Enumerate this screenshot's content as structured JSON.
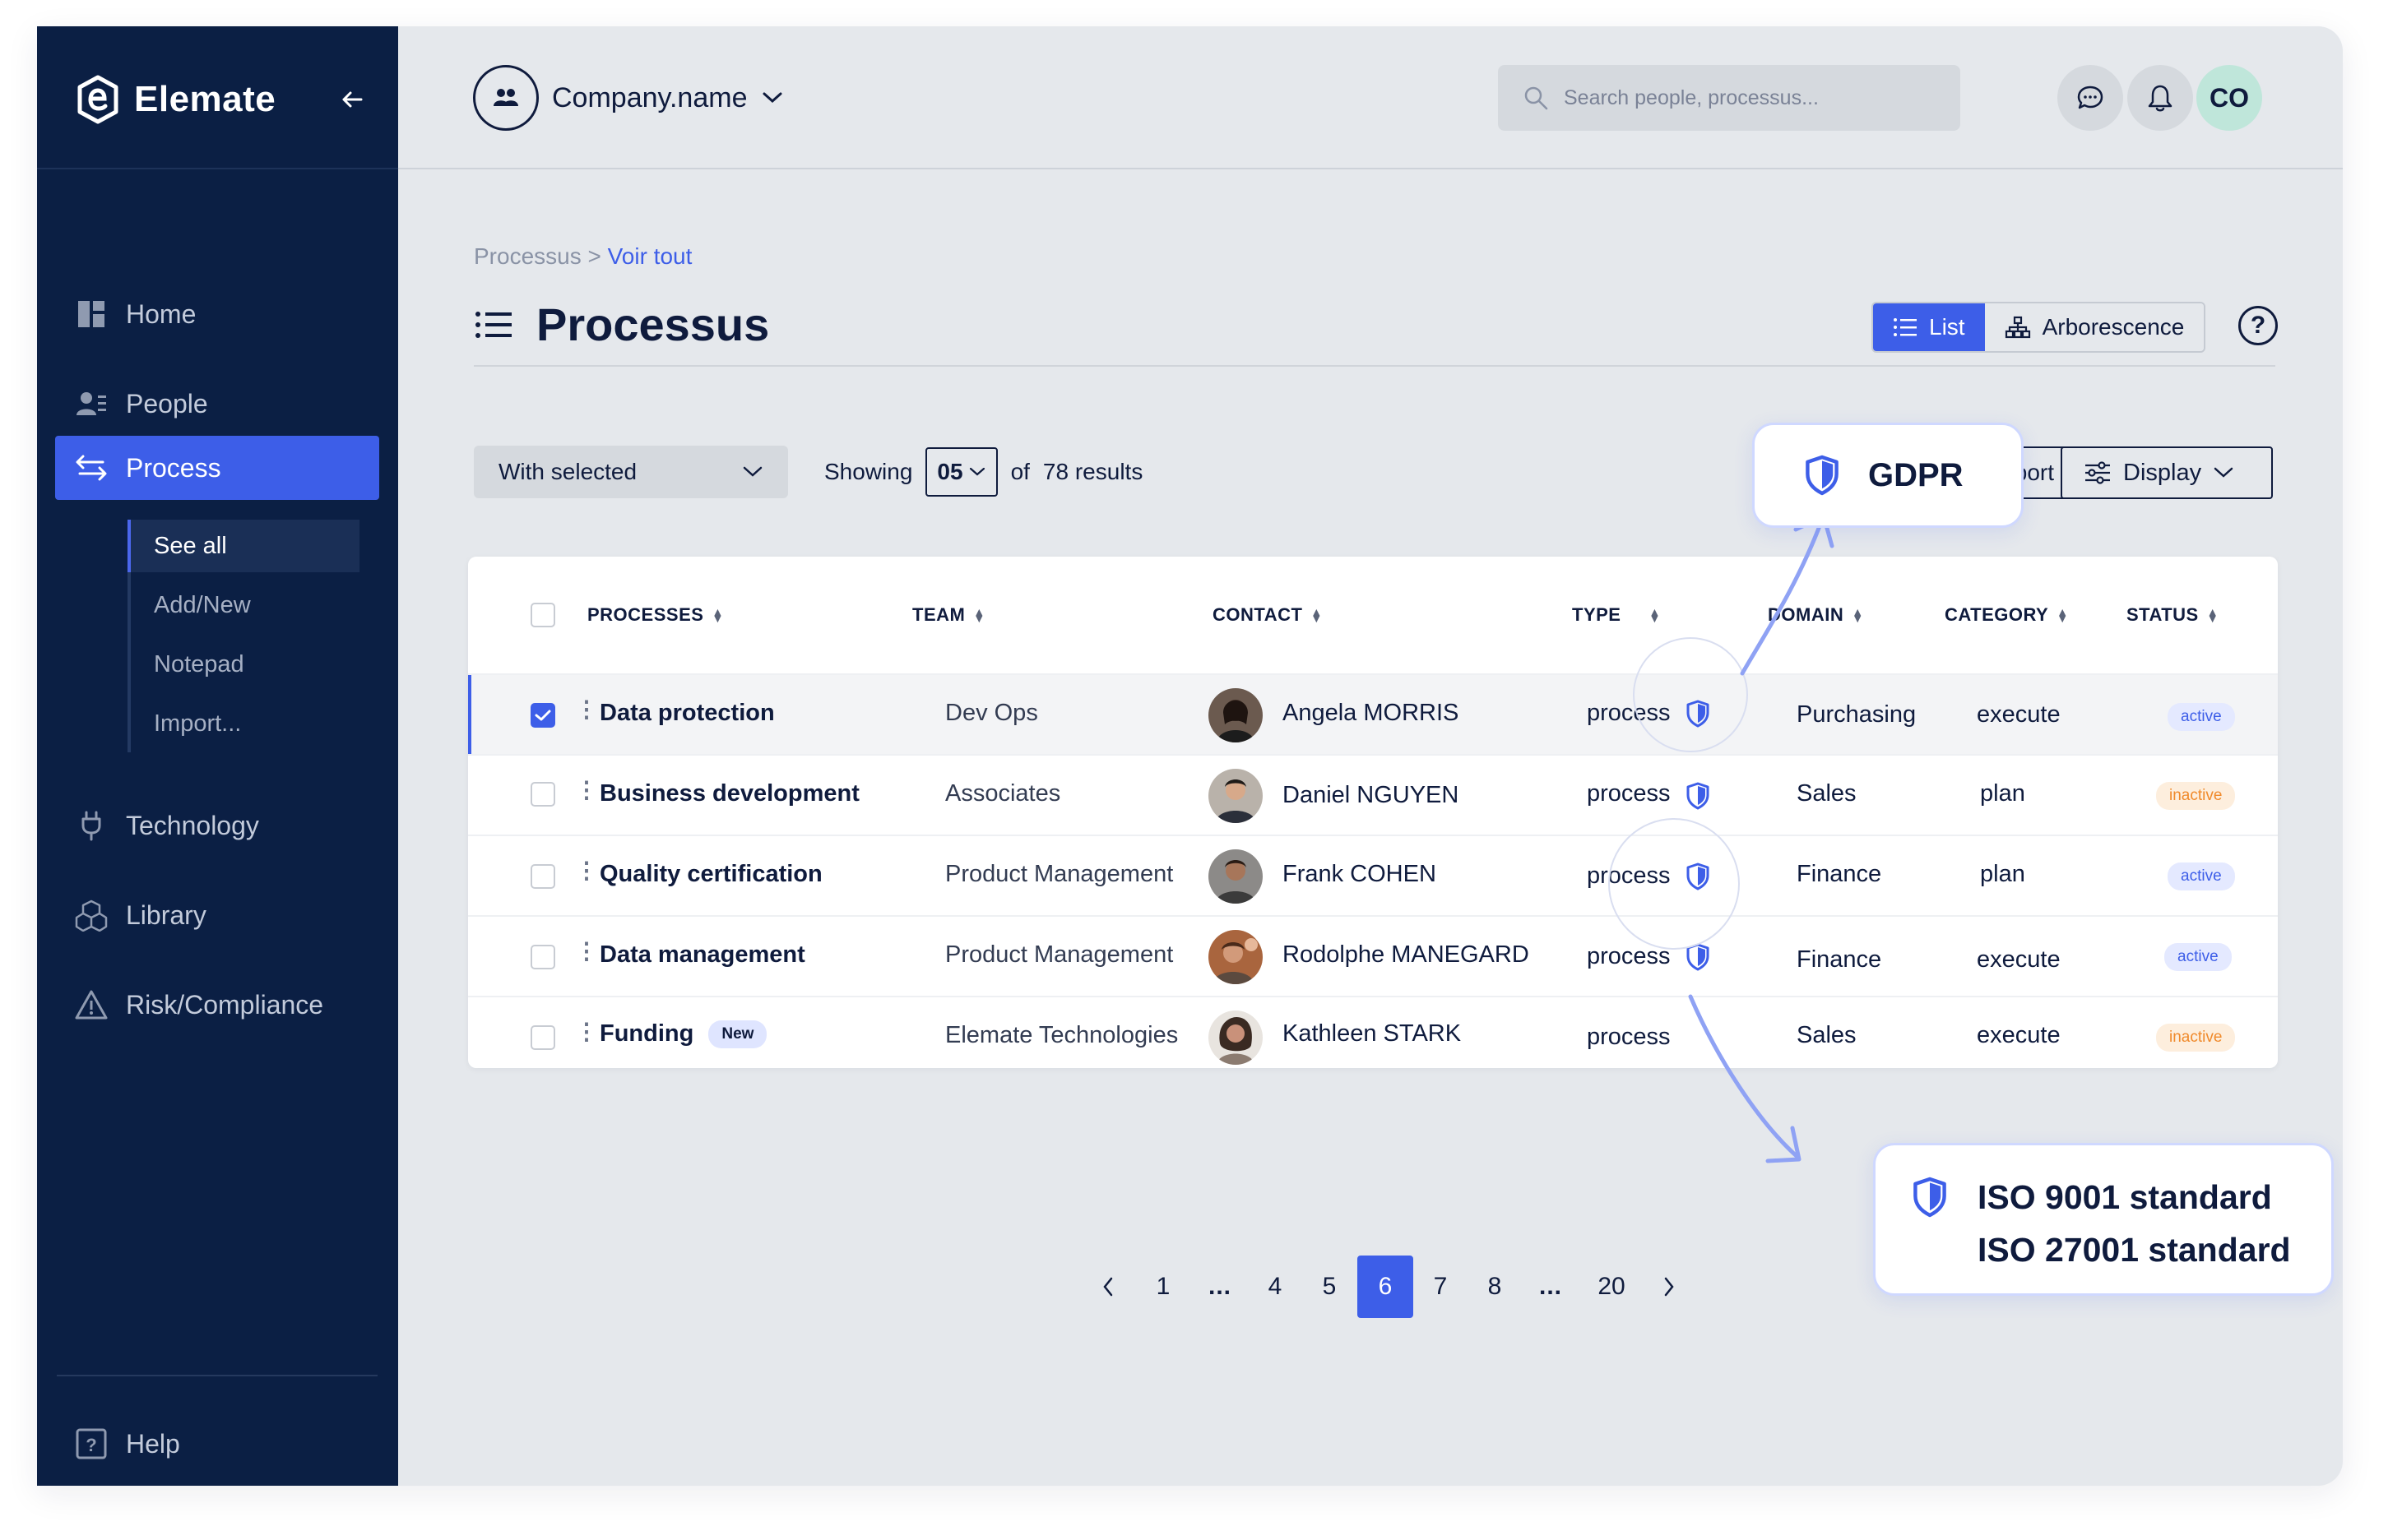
{
  "brand": {
    "name": "Elemate"
  },
  "sidebar": {
    "items": [
      {
        "label": "Home",
        "icon": "home-icon"
      },
      {
        "label": "People",
        "icon": "people-icon"
      },
      {
        "label": "Process",
        "icon": "process-icon"
      },
      {
        "label": "Technology",
        "icon": "technology-icon"
      },
      {
        "label": "Library",
        "icon": "library-icon"
      },
      {
        "label": "Risk/Compliance",
        "icon": "warning-icon"
      }
    ],
    "subitems": [
      "See all",
      "Add/New",
      "Notepad",
      "Import..."
    ],
    "help": "Help"
  },
  "header": {
    "company": "Company.name",
    "search_placeholder": "Search people, processus...",
    "user_initials": "CO"
  },
  "breadcrumb": {
    "parent": "Processus",
    "separator": ">",
    "current": "Voir tout"
  },
  "page": {
    "title": "Processus",
    "view_list": "List",
    "view_tree": "Arborescence"
  },
  "toolbar": {
    "with_selected": "With selected",
    "showing": "Showing",
    "per_page": "05",
    "of": "of",
    "results": "78 results",
    "export_partial": "port",
    "display": "Display"
  },
  "table": {
    "columns": [
      "PROCESSES",
      "TEAM",
      "CONTACT",
      "TYPE",
      "DOMAIN",
      "CATEGORY",
      "STATUS"
    ],
    "rows": [
      {
        "process": "Data protection",
        "team": "Dev Ops",
        "contact": "Angela MORRIS",
        "type": "process",
        "domain": "Purchasing",
        "category": "execute",
        "status": "active",
        "checked": true,
        "shield": true
      },
      {
        "process": "Business development",
        "team": "Associates",
        "contact": "Daniel NGUYEN",
        "type": "process",
        "domain": "Sales",
        "category": "plan",
        "status": "inactive",
        "checked": false,
        "shield": true
      },
      {
        "process": "Quality certification",
        "team": "Product Management",
        "contact": "Frank COHEN",
        "type": "process",
        "domain": "Finance",
        "category": "plan",
        "status": "active",
        "checked": false,
        "shield": true
      },
      {
        "process": "Data management",
        "team": "Product Management",
        "contact": "Rodolphe MANEGARD",
        "type": "process",
        "domain": "Finance",
        "category": "execute",
        "status": "active",
        "checked": false,
        "shield": true
      },
      {
        "process": "Funding",
        "badge": "New",
        "team": "Elemate Technologies",
        "contact": "Kathleen STARK",
        "type": "process",
        "domain": "Sales",
        "category": "execute",
        "status": "inactive",
        "checked": false,
        "shield": false
      }
    ]
  },
  "callouts": {
    "gdpr": "GDPR",
    "iso_1": "ISO 9001 standard",
    "iso_2": "ISO 27001 standard"
  },
  "pagination": {
    "pages": [
      "1",
      "...",
      "4",
      "5",
      "6",
      "7",
      "8",
      "...",
      "20"
    ],
    "current": "6"
  },
  "colors": {
    "sidebar_bg": "#0b1f44",
    "accent": "#3d5ee8",
    "status_active": "#3d5ee8",
    "status_inactive": "#f08a2b"
  }
}
